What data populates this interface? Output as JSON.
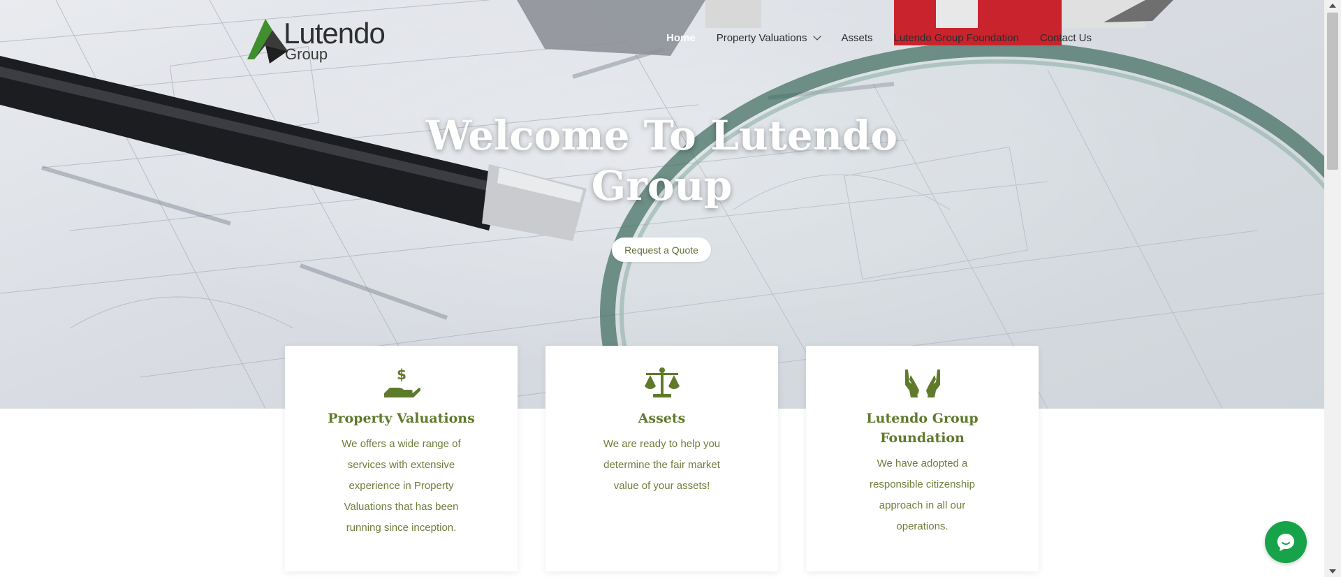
{
  "brand": {
    "name": "Lutendo",
    "sub": "Group",
    "logo_green": "#3f8f2f",
    "logo_dark": "#3a3a3a"
  },
  "nav": {
    "items": [
      {
        "label": "Home",
        "active": true
      },
      {
        "label": "Property Valuations",
        "has_dropdown": true
      },
      {
        "label": "Assets"
      },
      {
        "label": "Lutendo Group Foundation"
      },
      {
        "label": "Contact Us"
      }
    ]
  },
  "hero": {
    "title": "Welcome To Lutendo Group",
    "button": "Request a Quote"
  },
  "cards": [
    {
      "icon": "hand-dollar-icon",
      "title": "Property Valuations",
      "text": "We offers a wide range of services with extensive experience in Property Valuations that has been running since inception."
    },
    {
      "icon": "balance-scale-icon",
      "title": "Assets",
      "text": "We are ready to help you determine the fair market value of your assets!"
    },
    {
      "icon": "open-hands-icon",
      "title": "Lutendo Group Foundation",
      "text": "We have adopted a responsible citizenship approach in all our operations."
    }
  ],
  "colors": {
    "accent_green": "#5f7a2b",
    "text_green": "#6e7e3c",
    "chat_green": "#17a34a"
  },
  "chat": {
    "icon": "chat-bubble-icon"
  }
}
